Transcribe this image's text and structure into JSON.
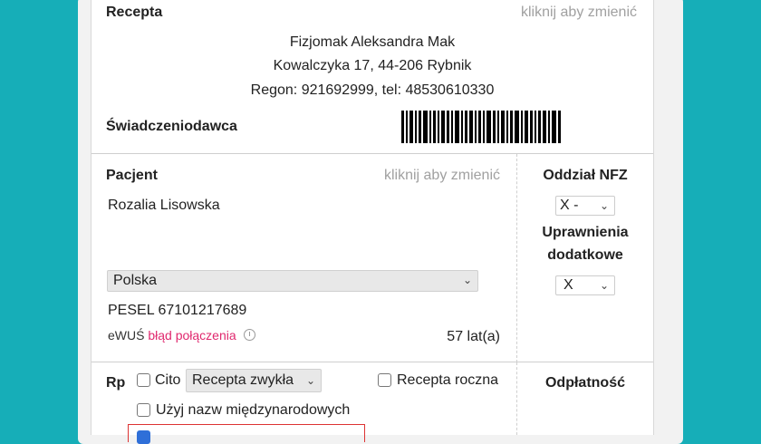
{
  "recepta": {
    "title": "Recepta",
    "change_hint": "kliknij aby zmienić",
    "provider_name": "Fizjomak Aleksandra Mak",
    "provider_address": "Kowalczyka  17, 44-206 Rybnik",
    "provider_regon": "Regon: 921692999, tel: 48530610330",
    "provider_label": "Świadczeniodawca"
  },
  "pacjent": {
    "title": "Pacjent",
    "change_hint": "kliknij aby zmienić",
    "name": "Rozalia Lisowska",
    "country": "Polska",
    "pesel": "PESEL  67101217689",
    "ewus_label": "eWUŚ",
    "ewus_status": "błąd połączenia",
    "age": "57  lat(a)"
  },
  "nfz": {
    "title": "Oddział NFZ",
    "oddzial_value": "X  - ",
    "uprawnienia_line1": "Uprawnienia",
    "uprawnienia_line2": "dodatkowe",
    "uprawnienia_value": "X"
  },
  "rp": {
    "label": "Rp",
    "cito_label": "Cito",
    "type_value": "Recepta zwykła",
    "annual_label": "Recepta roczna",
    "intl_label": "Użyj nazw międzynarodowych"
  },
  "odplatnosc": {
    "title": "Odpłatność"
  },
  "colors": {
    "background": "#16aeb8",
    "ewus_error": "#e0286e",
    "highlight_frame": "#d33"
  }
}
